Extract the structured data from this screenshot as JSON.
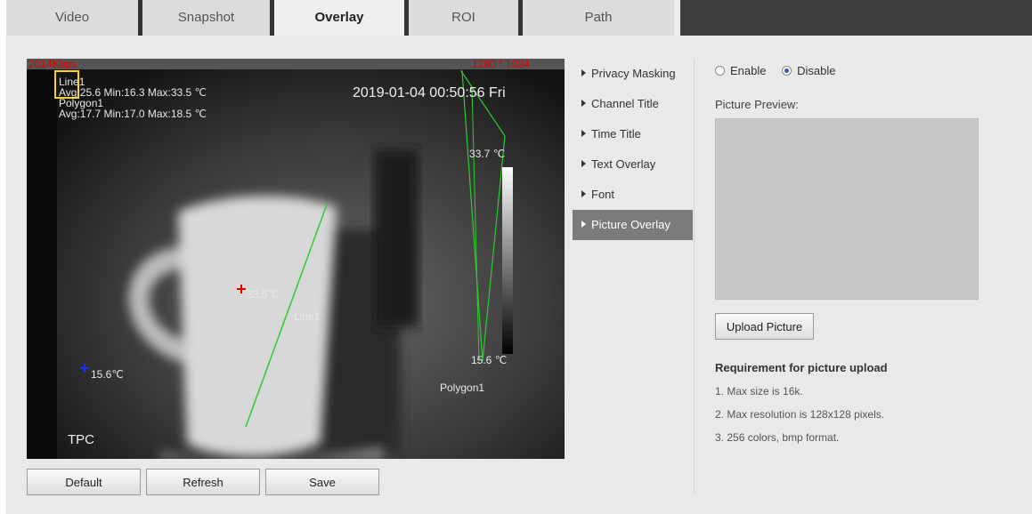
{
  "tabs": [
    {
      "label": "Video"
    },
    {
      "label": "Snapshot"
    },
    {
      "label": "Overlay"
    },
    {
      "label": "ROI"
    },
    {
      "label": "Path"
    }
  ],
  "video": {
    "bitrate": "2014Kbps",
    "resolution": "1280 * 1024",
    "datetime": "2019-01-04 00:50:56 Fri",
    "line_name": "Line1",
    "line_stats": "Avg:25.6 Min:16.3 Max:33.5 ℃",
    "polygon_name": "Polygon1",
    "polygon_stats": "Avg:17.7 Min:17.0 Max:18.5 ℃",
    "scale_max": "33.7 ℃",
    "scale_min": "15.6 ℃",
    "spot_hot": "33.5℃",
    "spot_cold": "15.6℃",
    "line_label": "Line1",
    "polygon_label": "Polygon1",
    "channel_title": "TPC",
    "colors": {
      "line": "#2ecc2e",
      "polygon": "#2ecc2e",
      "box": "#ffd800",
      "alert": "#e00000"
    }
  },
  "nav": [
    {
      "label": "Privacy Masking"
    },
    {
      "label": "Channel Title"
    },
    {
      "label": "Time Title"
    },
    {
      "label": "Text Overlay"
    },
    {
      "label": "Font"
    },
    {
      "label": "Picture Overlay",
      "active": true
    }
  ],
  "picture_overlay": {
    "enable_label": "Enable",
    "disable_label": "Disable",
    "selected": "Disable",
    "preview_label": "Picture Preview:",
    "upload_label": "Upload Picture",
    "requirement_title": "Requirement for picture upload",
    "requirements": [
      "1. Max size is 16k.",
      "2. Max resolution is 128x128 pixels.",
      "3. 256 colors, bmp format."
    ]
  },
  "buttons": {
    "default_label": "Default",
    "refresh_label": "Refresh",
    "save_label": "Save"
  }
}
